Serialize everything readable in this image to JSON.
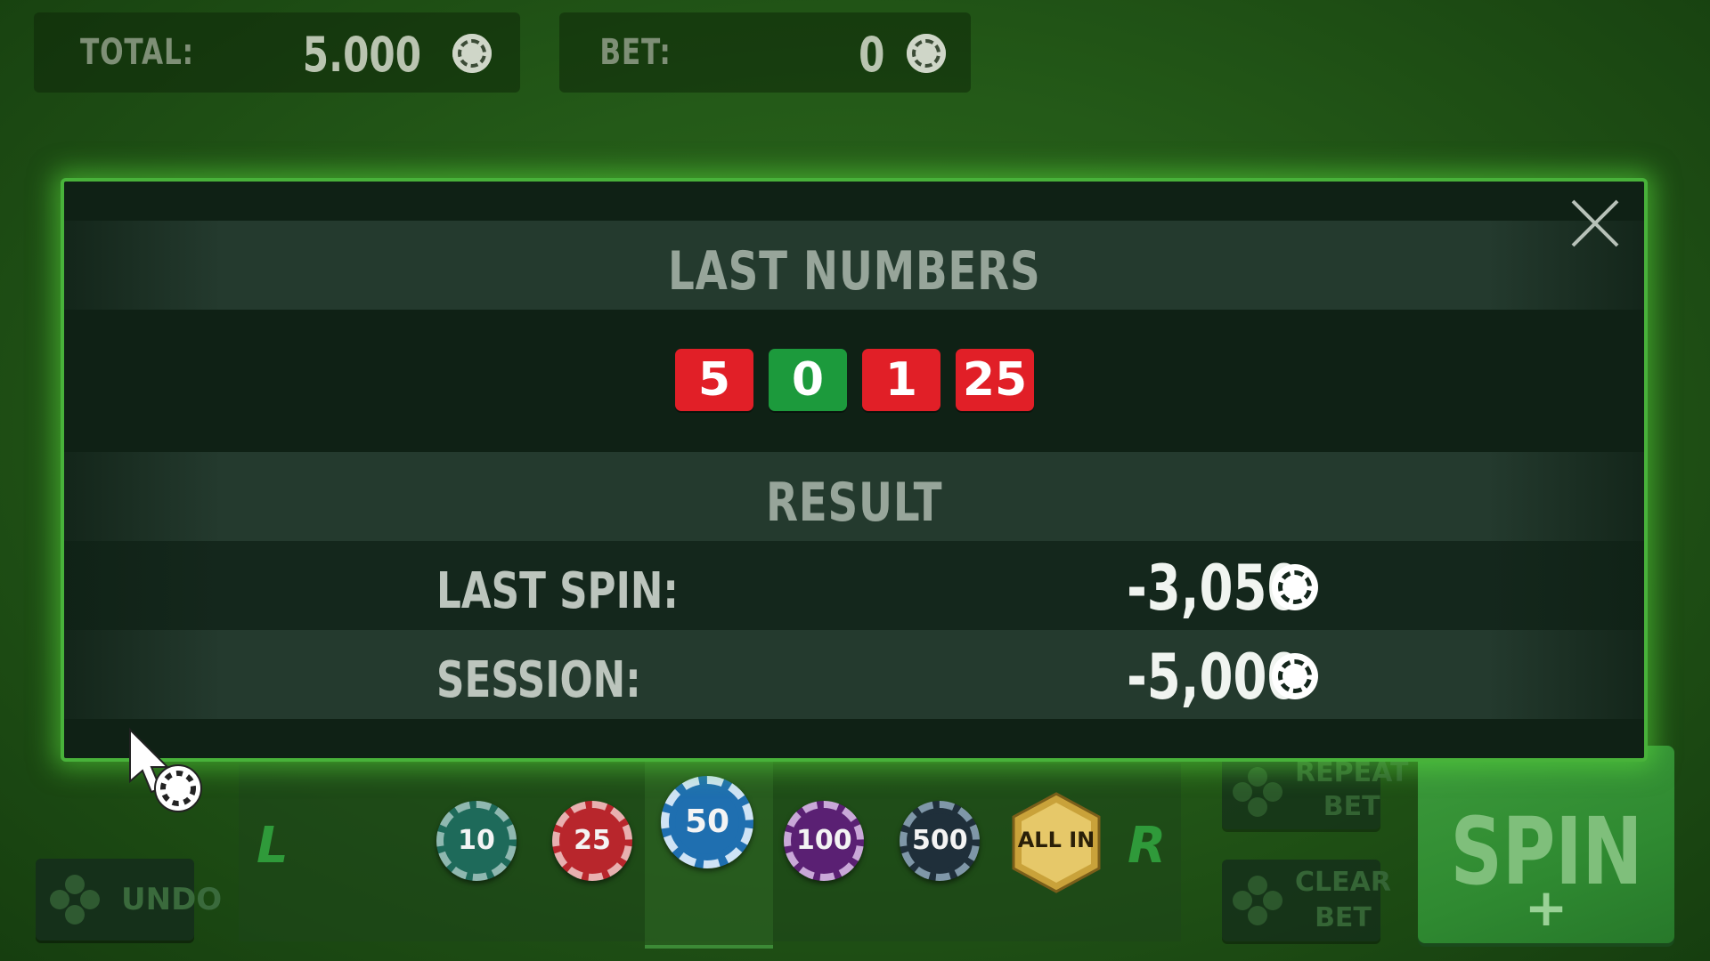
{
  "header": {
    "total_label": "TOTAL:",
    "total_value": "5.000",
    "bet_label": "BET:",
    "bet_value": "0"
  },
  "modal": {
    "last_numbers_title": "LAST NUMBERS",
    "last_numbers": [
      {
        "value": "5",
        "color": "#e11f27"
      },
      {
        "value": "0",
        "color": "#1c9a3c"
      },
      {
        "value": "1",
        "color": "#e11f27"
      },
      {
        "value": "25",
        "color": "#e11f27"
      }
    ],
    "result_title": "RESULT",
    "last_spin_label": "LAST SPIN:",
    "last_spin_value": "-3,050",
    "session_label": "SESSION:",
    "session_value": "-5,000"
  },
  "controls": {
    "undo_label": "UNDO",
    "left_label": "L",
    "right_label": "R",
    "chips": [
      {
        "value": "10",
        "color": "#1e6a5a"
      },
      {
        "value": "25",
        "color": "#b8262c"
      },
      {
        "value": "50",
        "color": "#1f6fb0"
      },
      {
        "value": "100",
        "color": "#5a2073"
      },
      {
        "value": "500",
        "color": "#1f2f3a"
      },
      {
        "value": "ALL IN",
        "color": "#c9a23a"
      }
    ],
    "repeat_bet_line1": "REPEAT",
    "repeat_bet_line2": "BET",
    "clear_bet_line1": "CLEAR",
    "clear_bet_line2": "BET",
    "spin_label": "SPIN",
    "spin_plus": "+"
  }
}
